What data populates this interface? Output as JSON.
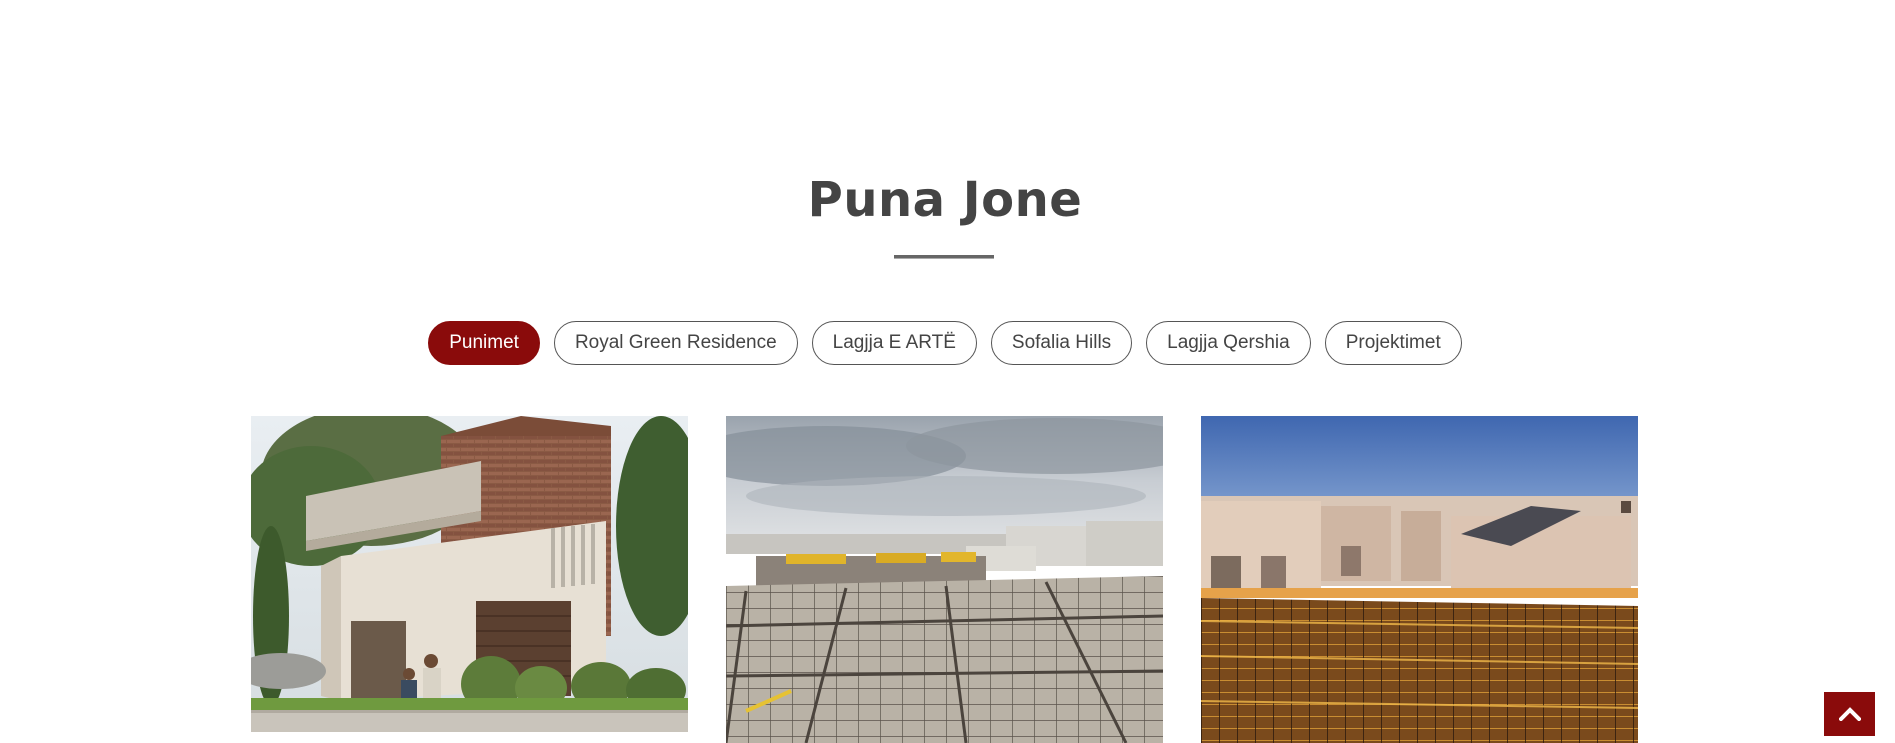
{
  "section": {
    "title": "Puna Jone"
  },
  "filters": [
    {
      "label": "Punimet",
      "active": true
    },
    {
      "label": "Royal Green Residence",
      "active": false
    },
    {
      "label": "Lagjja E ARTË",
      "active": false
    },
    {
      "label": "Sofalia Hills",
      "active": false
    },
    {
      "label": "Lagjja Qershia",
      "active": false
    },
    {
      "label": "Projektimet",
      "active": false
    }
  ],
  "gallery": [
    {
      "subject": "modern residential house rendering"
    },
    {
      "subject": "construction site rebar foundation under cloudy sky"
    },
    {
      "subject": "rooftop rebar grid at sunset with houses"
    }
  ],
  "colors": {
    "accent": "#8a0b0b",
    "title": "#444444"
  },
  "icons": {
    "scroll_top": "chevron-up-icon"
  }
}
